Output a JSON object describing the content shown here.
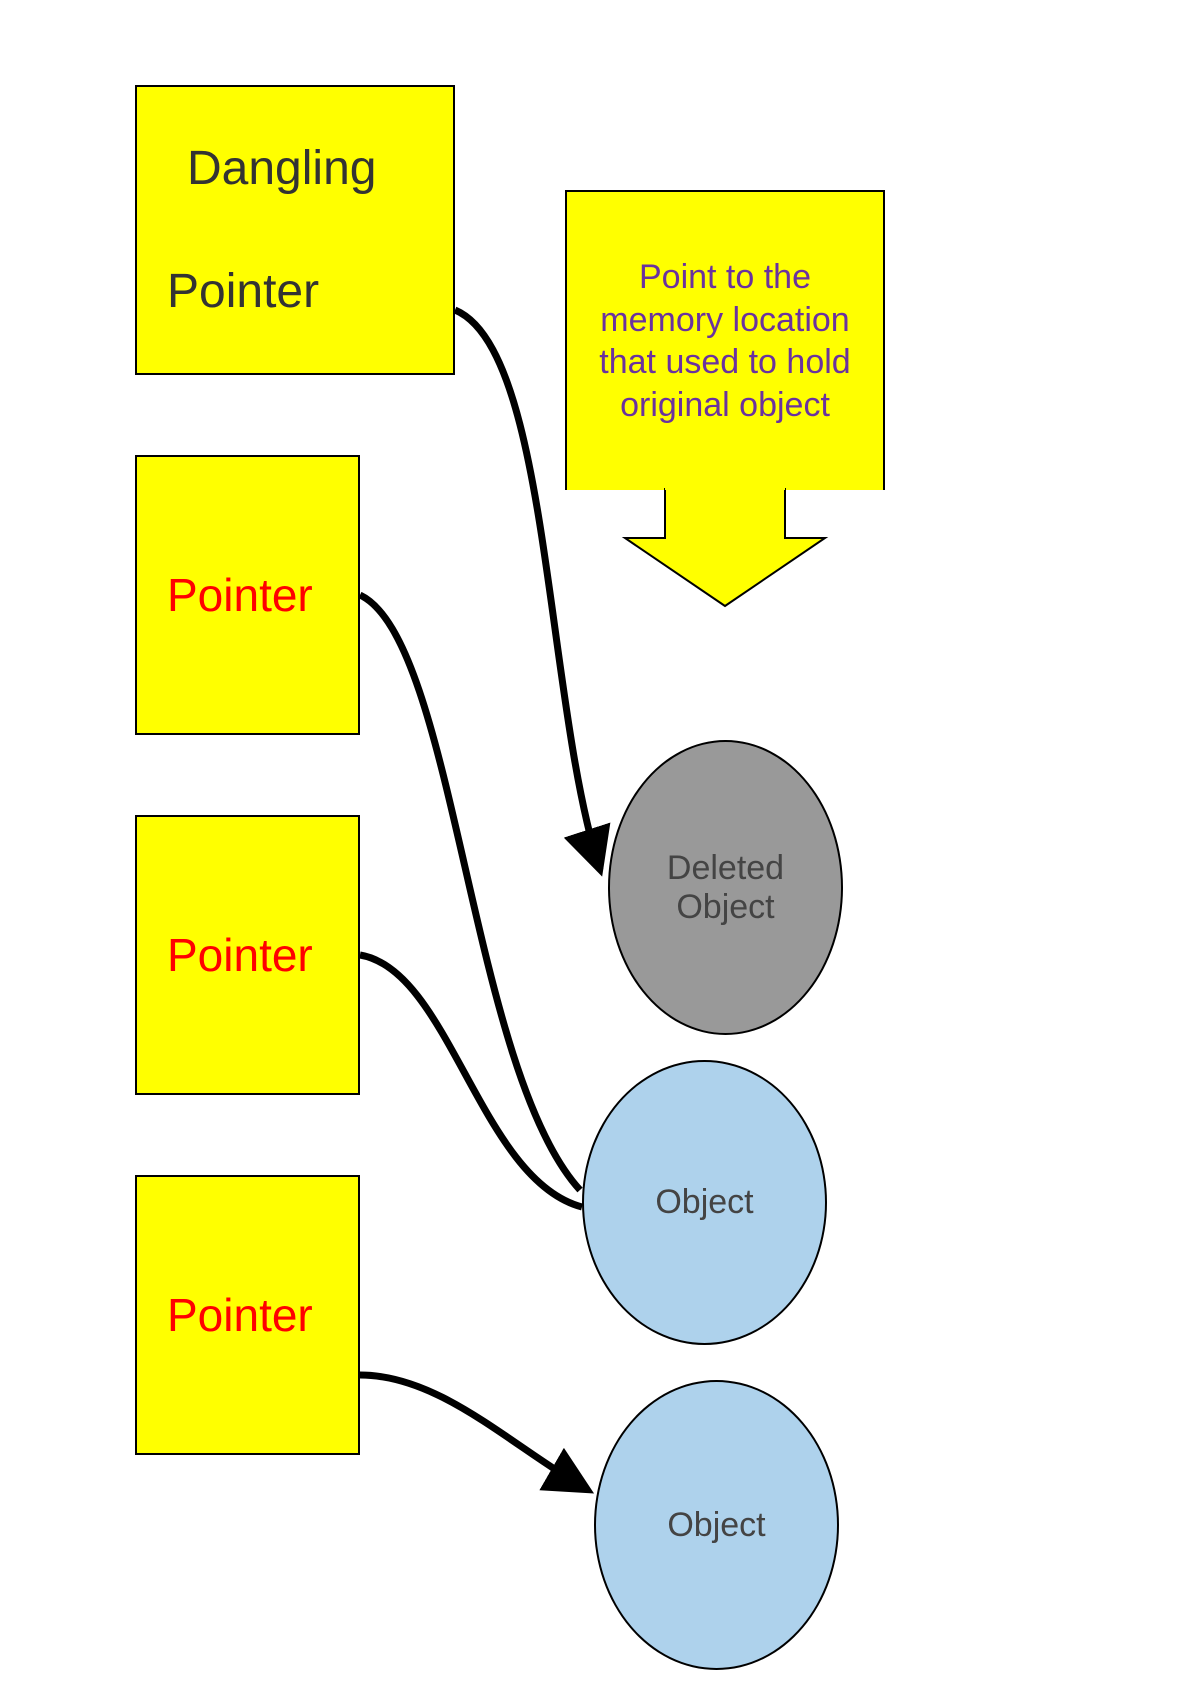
{
  "boxes": {
    "dangling_line1": "Dangling",
    "dangling_line2": "Pointer",
    "pointer2": "Pointer",
    "pointer3": "Pointer",
    "pointer4": "Pointer"
  },
  "objects": {
    "deleted_line1": "Deleted",
    "deleted_line2": "Object",
    "object2": "Object",
    "object3": "Object"
  },
  "callout_text": "Point to the memory location that used to hold original object",
  "colors": {
    "box_fill": "#ffff00",
    "box_stroke": "#000000",
    "pointer_text": "#ff0000",
    "callout_text": "#6a329f",
    "object_fill": "#aed2ec",
    "deleted_fill": "#999999"
  }
}
